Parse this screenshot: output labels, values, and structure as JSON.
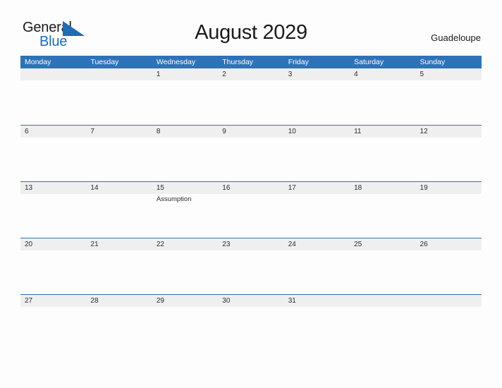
{
  "brand": {
    "name_part1": "General",
    "name_part2": "Blue",
    "flag_icon": "blue-triangle-flag-icon",
    "color_dark": "#1a1a1a",
    "color_blue": "#1f6cb4"
  },
  "header": {
    "title": "August 2029",
    "locale": "Guadeloupe"
  },
  "calendar": {
    "accent_color": "#2e72b8",
    "date_band_color": "#efefef",
    "weekdays": [
      "Monday",
      "Tuesday",
      "Wednesday",
      "Thursday",
      "Friday",
      "Saturday",
      "Sunday"
    ],
    "weeks": [
      {
        "days": [
          {
            "date": "",
            "events": []
          },
          {
            "date": "",
            "events": []
          },
          {
            "date": "1",
            "events": []
          },
          {
            "date": "2",
            "events": []
          },
          {
            "date": "3",
            "events": []
          },
          {
            "date": "4",
            "events": []
          },
          {
            "date": "5",
            "events": []
          }
        ]
      },
      {
        "days": [
          {
            "date": "6",
            "events": []
          },
          {
            "date": "7",
            "events": []
          },
          {
            "date": "8",
            "events": []
          },
          {
            "date": "9",
            "events": []
          },
          {
            "date": "10",
            "events": []
          },
          {
            "date": "11",
            "events": []
          },
          {
            "date": "12",
            "events": []
          }
        ]
      },
      {
        "days": [
          {
            "date": "13",
            "events": []
          },
          {
            "date": "14",
            "events": []
          },
          {
            "date": "15",
            "events": [
              "Assumption"
            ]
          },
          {
            "date": "16",
            "events": []
          },
          {
            "date": "17",
            "events": []
          },
          {
            "date": "18",
            "events": []
          },
          {
            "date": "19",
            "events": []
          }
        ]
      },
      {
        "days": [
          {
            "date": "20",
            "events": []
          },
          {
            "date": "21",
            "events": []
          },
          {
            "date": "22",
            "events": []
          },
          {
            "date": "23",
            "events": []
          },
          {
            "date": "24",
            "events": []
          },
          {
            "date": "25",
            "events": []
          },
          {
            "date": "26",
            "events": []
          }
        ]
      },
      {
        "days": [
          {
            "date": "27",
            "events": []
          },
          {
            "date": "28",
            "events": []
          },
          {
            "date": "29",
            "events": []
          },
          {
            "date": "30",
            "events": []
          },
          {
            "date": "31",
            "events": []
          },
          {
            "date": "",
            "events": []
          },
          {
            "date": "",
            "events": []
          }
        ]
      }
    ]
  }
}
